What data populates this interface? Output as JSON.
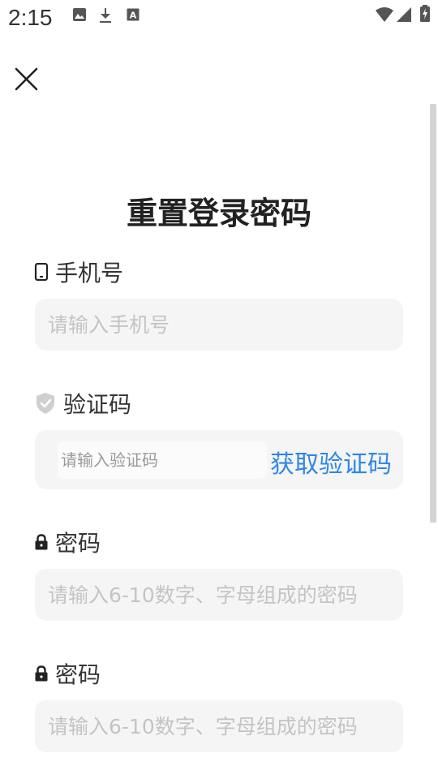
{
  "status_bar": {
    "time": "2:15",
    "left_icons": [
      "image-icon",
      "download-icon",
      "text-a-icon"
    ],
    "right_icons": [
      "wifi-icon",
      "signal-icon",
      "battery-charging-icon"
    ]
  },
  "header": {
    "close_icon": "close-icon"
  },
  "page": {
    "title": "重置登录密码"
  },
  "form": {
    "phone": {
      "label": "手机号",
      "icon": "phone-icon",
      "placeholder": "请输入手机号"
    },
    "code": {
      "label": "验证码",
      "icon": "shield-check-icon",
      "placeholder": "请输入验证码",
      "button_label": "获取验证码"
    },
    "password": {
      "label": "密码",
      "icon": "lock-icon",
      "placeholder": "请输入6-10数字、字母组成的密码"
    },
    "password_confirm": {
      "label": "密码",
      "icon": "lock-icon",
      "placeholder": "请输入6-10数字、字母组成的密码"
    }
  },
  "colors": {
    "accent": "#2f86e6",
    "input_background": "#f5f5f5",
    "placeholder": "#c4c4c4"
  }
}
